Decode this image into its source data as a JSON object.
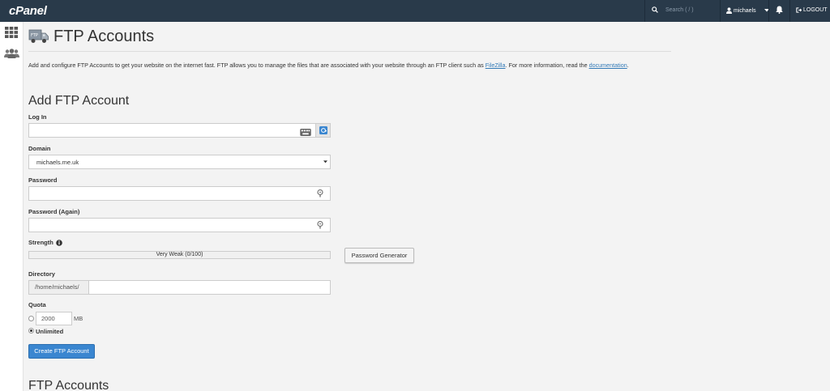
{
  "topbar": {
    "logo": "cPanel",
    "search_placeholder": "Search ( / )",
    "username": "michaels",
    "logout_label": "LOGOUT"
  },
  "page": {
    "title": "FTP Accounts",
    "description_prefix": "Add and configure FTP Accounts to get your website on the internet fast. FTP allows you to manage the files that are associated with your website through an FTP client such as ",
    "filezilla_link": "FileZilla",
    "description_middle": ". For more information, read the ",
    "documentation_link": "documentation",
    "description_suffix": "."
  },
  "add_form": {
    "section_title": "Add FTP Account",
    "login_label": "Log In",
    "login_value": "",
    "domain_label": "Domain",
    "domain_value": "michaels.me.uk",
    "password_label": "Password",
    "password_again_label": "Password (Again)",
    "strength_label": "Strength",
    "strength_value": "Very Weak (0/100)",
    "password_generator_label": "Password Generator",
    "directory_label": "Directory",
    "directory_prefix": "/home/michaels/",
    "directory_value": "",
    "quota_label": "Quota",
    "quota_value": "2000",
    "quota_unit": "MB",
    "unlimited_label": "Unlimited",
    "quota_selected": "Unlimited",
    "create_button_label": "Create FTP Account"
  },
  "list_section": {
    "title": "FTP Accounts"
  },
  "colors": {
    "topbar_bg": "#293a4a",
    "accent_orange": "#ff6c2c",
    "primary_button": "#3a86d0",
    "link": "#337ab7"
  },
  "icons": [
    "search-icon",
    "user-icon",
    "caret-down-icon",
    "bell-icon",
    "logout-icon",
    "grid-icon",
    "users-icon",
    "ftp-truck-icon",
    "keyboard-icon",
    "email-icon",
    "key-icon",
    "info-icon"
  ]
}
